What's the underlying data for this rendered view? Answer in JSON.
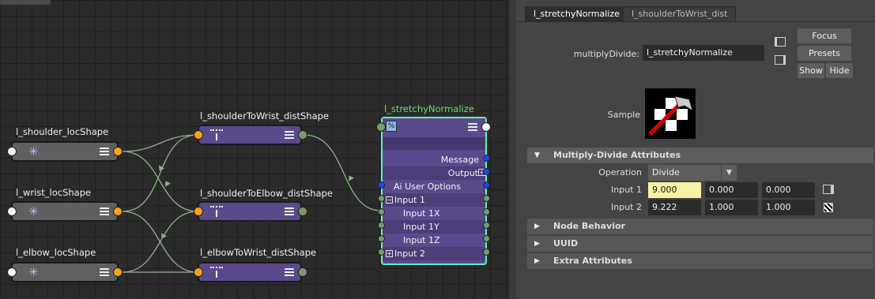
{
  "graph": {
    "nodes": {
      "shoulder_loc": "l_shoulder_locShape",
      "wrist_loc": "l_wrist_locShape",
      "elbow_loc": "l_elbow_locShape",
      "shoulder_to_wrist": "l_shoulderToWrist_distShape",
      "shoulder_to_elbow": "l_shoulderToElbow_distShape",
      "elbow_to_wrist": "l_elbowToWrist_distShape"
    },
    "md_node": {
      "title": "l_stretchyNormalize",
      "rows": {
        "message": "Message",
        "output": "Output",
        "ai_user_options": "Ai User Options",
        "input1": "Input 1",
        "input1x": "Input 1X",
        "input1y": "Input 1Y",
        "input1z": "Input 1Z",
        "input2": "Input 2"
      }
    }
  },
  "attribute_editor": {
    "tabs": [
      "l_stretchyNormalize",
      "l_shoulderToWrist_dist"
    ],
    "node_type_label": "multiplyDivide:",
    "node_name": "l_stretchyNormalize",
    "buttons": {
      "focus": "Focus",
      "presets": "Presets",
      "show": "Show",
      "hide": "Hide"
    },
    "sample_label": "Sample",
    "sections": {
      "multiply_divide": "Multiply-Divide Attributes",
      "node_behavior": "Node Behavior",
      "uuid": "UUID",
      "extra": "Extra Attributes"
    },
    "operation": {
      "label": "Operation",
      "value": "Divide"
    },
    "input1": {
      "label": "Input 1",
      "x": "9.000",
      "y": "0.000",
      "z": "0.000"
    },
    "input2": {
      "label": "Input 2",
      "x": "9.222",
      "y": "1.000",
      "z": "1.000"
    }
  },
  "colors": {
    "accent_node_border": "#5ff0c0",
    "node_title_green": "#5fe06e",
    "port_orange": "#f5a21c",
    "field_highlight": "#f6f3a5"
  }
}
